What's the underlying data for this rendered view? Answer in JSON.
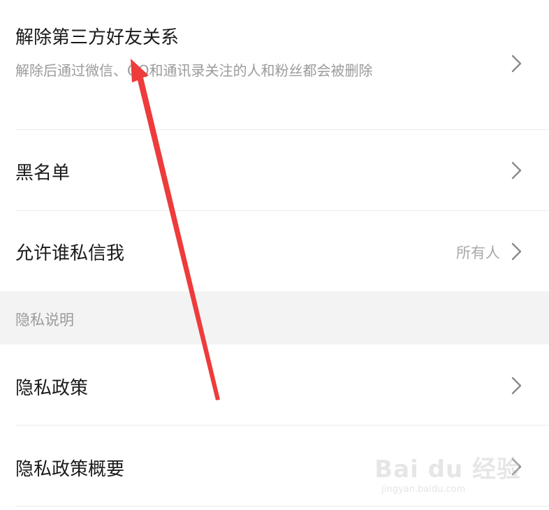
{
  "rows": [
    {
      "title": "解除第三方好友关系",
      "desc": "解除后通过微信、QQ和通讯录关注的人和粉丝都会被删除"
    },
    {
      "title": "黑名单"
    },
    {
      "title": "允许谁私信我",
      "value": "所有人"
    }
  ],
  "section": {
    "label": "隐私说明"
  },
  "rows2": [
    {
      "title": "隐私政策"
    },
    {
      "title": "隐私政策概要"
    }
  ],
  "watermark": {
    "brand": "Bai du 经验",
    "url": "jingyan.baidu.com"
  },
  "colors": {
    "annotation_arrow": "#ee3b3b",
    "section_bg": "#f3f3f3"
  }
}
